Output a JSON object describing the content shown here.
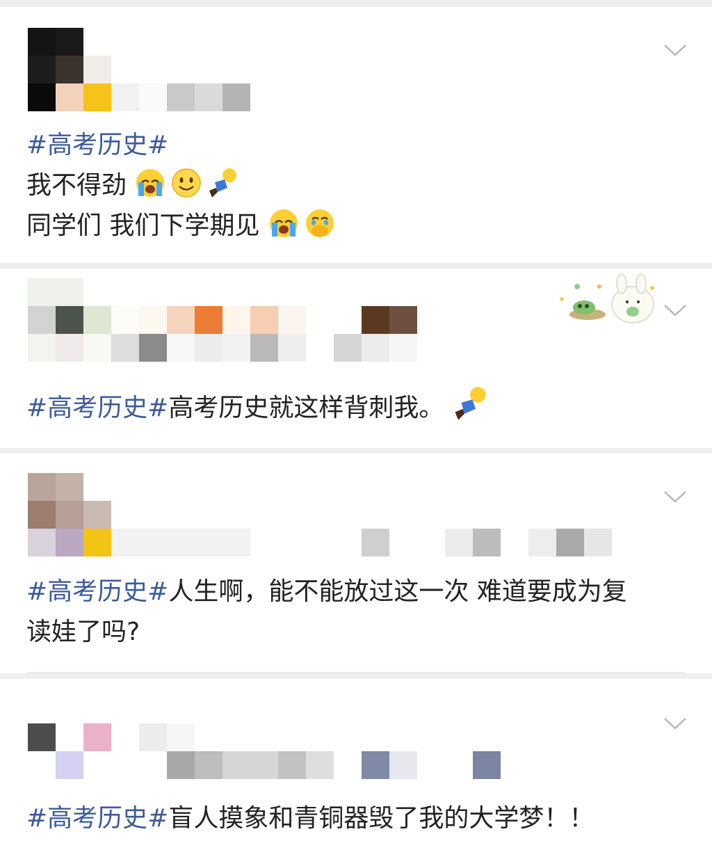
{
  "posts": [
    {
      "hashtag": "#高考历史#",
      "lines": [
        "我不得劲",
        "同学们 我们下学期见"
      ],
      "emoji_icons": [
        [
          "crying-face-icon",
          "smiley-face-icon",
          "fallen-person-icon"
        ],
        [
          "crying-face-icon",
          "covering-mouth-face-icon"
        ]
      ]
    },
    {
      "hashtag": "#高考历史#",
      "text": "高考历史就这样背刺我。",
      "emoji_icons": [
        "fallen-person-icon"
      ],
      "sticker_icon": "bunny-sticker-icon"
    },
    {
      "hashtag": "#高考历史#",
      "text": "人生啊，能不能放过这一次 难道要成为复",
      "text_line2": "读娃了吗?"
    },
    {
      "hashtag": "#高考历史#",
      "text": "盲人摸象和青铜器毁了我的大学梦！！"
    }
  ],
  "colors": {
    "hashtag": "#3d5a9a",
    "text": "#222222",
    "background": "#eeeeee"
  }
}
